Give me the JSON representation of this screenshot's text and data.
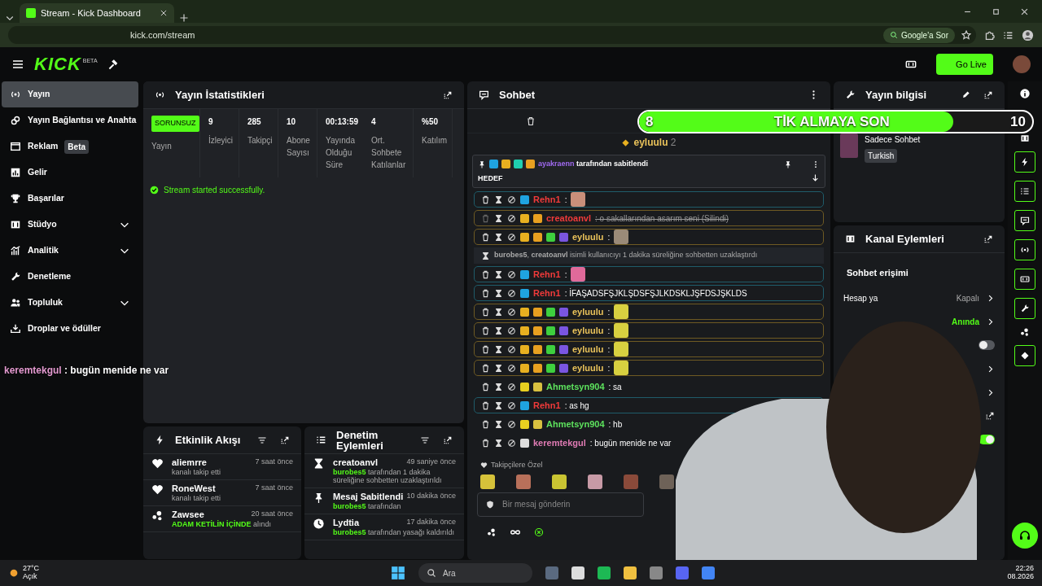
{
  "browser": {
    "tab_title": "Stream - Kick Dashboard",
    "address": "kick.com/stream",
    "ask_button": "Google'a Sor"
  },
  "topbar": {
    "logo": "KICK",
    "logo_tag": "BETA",
    "go_live": "Go Live"
  },
  "sidebar": {
    "items": [
      {
        "label": "Yayın",
        "selected": true,
        "expandable": false
      },
      {
        "label": "Yayın Bağlantısı ve Anahta",
        "selected": false,
        "expandable": false
      },
      {
        "label": "Reklam",
        "selected": false,
        "expandable": false,
        "tag": "Beta"
      },
      {
        "label": "Gelir",
        "selected": false,
        "expandable": false
      },
      {
        "label": "Başarılar",
        "selected": false,
        "expandable": false
      },
      {
        "label": "Stüdyo",
        "selected": false,
        "expandable": true
      },
      {
        "label": "Analitik",
        "selected": false,
        "expandable": true
      },
      {
        "label": "Denetleme",
        "selected": false,
        "expandable": false
      },
      {
        "label": "Topluluk",
        "selected": false,
        "expandable": true
      },
      {
        "label": "Droplar ve ödüller",
        "selected": false,
        "expandable": false
      }
    ],
    "overlay_chat": {
      "user": "keremtekgul",
      "text": " : bugün menide ne var"
    }
  },
  "stats": {
    "title": "Yayın İstatistikleri",
    "status": "SORUNSUZ",
    "status_label": "Yayın",
    "items": [
      {
        "value": "9",
        "label": "İzleyici"
      },
      {
        "value": "285",
        "label": "Takipçi"
      },
      {
        "value": "10",
        "label": "Abone Sayısı"
      },
      {
        "value": "00:13:59",
        "label": "Yayında Olduğu Süre"
      },
      {
        "value": "4",
        "label": "Ort. Sohbete Katılanlar"
      },
      {
        "value": "%50",
        "label": "Katılım"
      }
    ],
    "notice": "Stream started successfully."
  },
  "events": {
    "title": "Etkinlik Akışı",
    "items": [
      {
        "user": "aliemrre",
        "text": "kanalı takip etti",
        "time": "7 saat önce"
      },
      {
        "user": "RoneWest",
        "text": "kanalı takip etti",
        "time": "7 saat önce"
      },
      {
        "user": "Zawsee",
        "accent": "ADAM KETİLİN İÇİNDE",
        "text": "alındı",
        "time": "20 saat önce"
      }
    ]
  },
  "moderation": {
    "title": "Denetim Eylemleri",
    "items": [
      {
        "title": "creatoanvl",
        "accent": "burobes5",
        "text": "tarafından 1 dakika süreliğine sohbetten uzaklaştırıldı",
        "time": "49 saniye önce"
      },
      {
        "title": "Mesaj Sabitlendi",
        "accent": "burobes5",
        "text": "tarafından",
        "time": "10 dakika önce"
      },
      {
        "title": "Lydtia",
        "accent": "burobes5",
        "text": "tarafından yasağı kaldırıldı",
        "time": "17 dakika önce"
      }
    ]
  },
  "chat": {
    "title": "Sohbet",
    "top_gifter": {
      "user": "eyluulu",
      "count": "2"
    },
    "pinned": {
      "badges": [
        {
          "color": "#1fa3e0"
        },
        {
          "color": "#e8b020"
        },
        {
          "color": "#1fcfb0"
        },
        {
          "color": "#e8a020"
        }
      ],
      "user": "ayakraenn",
      "text": "tarafından sabitlendi",
      "message": "HEDEF"
    },
    "messages": [
      {
        "kind": "moderator",
        "badges": [
          {
            "color": "#1fa3e0"
          }
        ],
        "user": "Rehn1",
        "color": "#f03a3a",
        "text": ":",
        "emote": {
          "color": "#c98f7a"
        },
        "deleted": false
      },
      {
        "kind": "subscriber",
        "badges": [
          {
            "color": "#e8b020"
          },
          {
            "color": "#e8a020"
          }
        ],
        "user": "creatoanvl",
        "color": "#f03a3a",
        "text": ": o sakallarından asarım seni (Silindi)",
        "deleted": true
      },
      {
        "kind": "subscriber",
        "badges": [
          {
            "color": "#e8b020"
          },
          {
            "color": "#e8a020"
          },
          {
            "color": "#3ecf3e"
          },
          {
            "color": "#7a55e0"
          }
        ],
        "user": "eyluulu",
        "color": "#e9c25a",
        "text": ":",
        "emote": {
          "color": "#9a8a78"
        },
        "deleted": false
      },
      {
        "kind": "system",
        "text": "**burobes5**, **creatoanvl** isimli kullanıcıyı 1 dakika süreliğine sohbetten uzaklaştırdı"
      },
      {
        "kind": "moderator",
        "badges": [
          {
            "color": "#1fa3e0"
          }
        ],
        "user": "Rehn1",
        "color": "#f03a3a",
        "text": ":",
        "emote": {
          "color": "#e06a9a"
        },
        "deleted": false
      },
      {
        "kind": "moderator",
        "badges": [
          {
            "color": "#1fa3e0"
          }
        ],
        "user": "Rehn1",
        "color": "#f03a3a",
        "text": ": İFAŞADSFŞJKLŞDSFŞJLKDSKLJŞFDSJŞKLDS",
        "deleted": false
      },
      {
        "kind": "subscriber",
        "badges": [
          {
            "color": "#e8b020"
          },
          {
            "color": "#e8a020"
          },
          {
            "color": "#3ecf3e"
          },
          {
            "color": "#7a55e0"
          }
        ],
        "user": "eyluulu",
        "color": "#e9c25a",
        "text": ":",
        "emote": {
          "color": "#d8d040"
        },
        "deleted": false
      },
      {
        "kind": "subscriber",
        "badges": [
          {
            "color": "#e8b020"
          },
          {
            "color": "#e8a020"
          },
          {
            "color": "#3ecf3e"
          },
          {
            "color": "#7a55e0"
          }
        ],
        "user": "eyluulu",
        "color": "#e9c25a",
        "text": ":",
        "emote": {
          "color": "#d8d040"
        },
        "deleted": false
      },
      {
        "kind": "subscriber",
        "badges": [
          {
            "color": "#e8b020"
          },
          {
            "color": "#e8a020"
          },
          {
            "color": "#3ecf3e"
          },
          {
            "color": "#7a55e0"
          }
        ],
        "user": "eyluulu",
        "color": "#e9c25a",
        "text": ":",
        "emote": {
          "color": "#d8d040"
        },
        "deleted": false
      },
      {
        "kind": "subscriber",
        "badges": [
          {
            "color": "#e8b020"
          },
          {
            "color": "#e8a020"
          },
          {
            "color": "#3ecf3e"
          },
          {
            "color": "#7a55e0"
          }
        ],
        "user": "eyluulu",
        "color": "#e9c25a",
        "text": ":",
        "emote": {
          "color": "#d8d040"
        },
        "deleted": false
      },
      {
        "kind": "viewer",
        "badges": [
          {
            "color": "#e8d020"
          },
          {
            "color": "#d8c040"
          }
        ],
        "user": "Ahmetsyn904",
        "color": "#5de25d",
        "text": ": sa",
        "deleted": false
      },
      {
        "kind": "moderator",
        "badges": [
          {
            "color": "#1fa3e0"
          }
        ],
        "user": "Rehn1",
        "color": "#f03a3a",
        "text": ": as hg",
        "deleted": false
      },
      {
        "kind": "viewer",
        "badges": [
          {
            "color": "#e8d020"
          },
          {
            "color": "#d8c040"
          }
        ],
        "user": "Ahmetsyn904",
        "color": "#5de25d",
        "text": ": hb",
        "deleted": false
      },
      {
        "kind": "viewer",
        "badges": [
          {
            "color": "#dddddd"
          }
        ],
        "user": "keremtekgul",
        "color": "#e07bb4",
        "text": ": bugün menide ne var",
        "deleted": false
      }
    ],
    "emote_section": {
      "label": "Takipçilere Özel",
      "emotes": [
        {
          "color": "#d6c23a"
        },
        {
          "color": "#b8705a"
        },
        {
          "color": "#c9c432"
        },
        {
          "color": "#c79aa6"
        },
        {
          "color": "#8a4a3a"
        },
        {
          "color": "#6e6258"
        }
      ]
    },
    "input": {
      "placeholder": "Bir mesaj gönderin"
    }
  },
  "stream_info": {
    "title": "Yayın bilgisi",
    "category": "Sadece Sohbet",
    "tag": "Turkish"
  },
  "channel_actions": {
    "title": "Kanal Eylemleri",
    "section": "Sohbet erişimi",
    "rows": [
      {
        "kind": "select",
        "label": "Hesap ya",
        "value": "Kapalı",
        "active": false
      },
      {
        "kind": "select",
        "value": "Anında",
        "active": true
      },
      {
        "kind": "toggle",
        "on": false
      },
      {
        "kind": "select"
      },
      {
        "kind": "select"
      },
      {
        "kind": "link"
      },
      {
        "kind": "toggle",
        "on": true
      }
    ]
  },
  "goal_bar": {
    "current": "8",
    "label": "TİK ALMAYA SON",
    "target": "10",
    "level": 0.8
  },
  "taskbar": {
    "temperature": "27°C",
    "weather": "Açık",
    "search": "Ara",
    "time": "22:26",
    "date": "08.2026"
  }
}
